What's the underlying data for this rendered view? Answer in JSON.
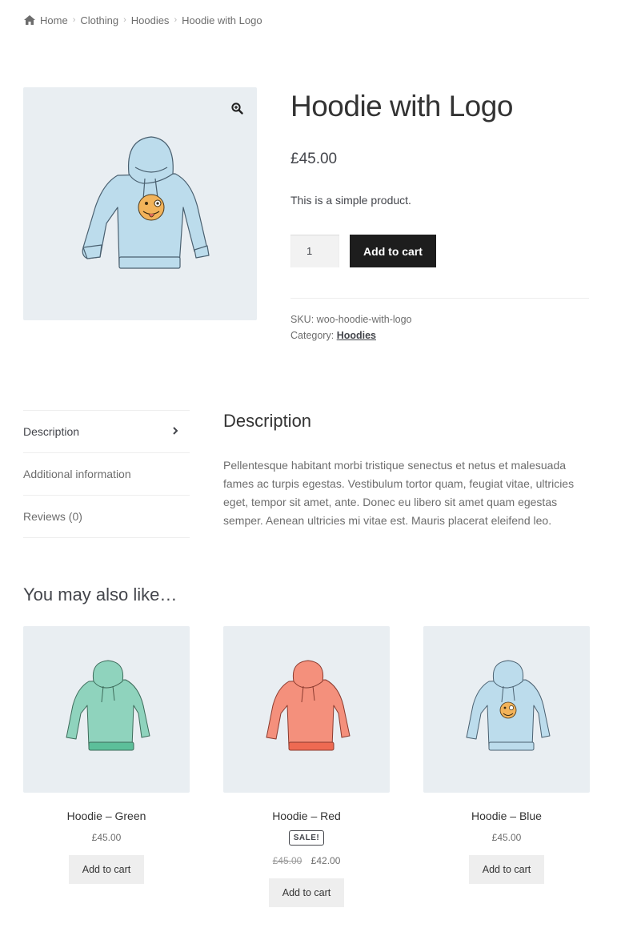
{
  "breadcrumb": {
    "icon": "home-icon",
    "items": [
      "Home",
      "Clothing",
      "Hoodies",
      "Hoodie with Logo"
    ]
  },
  "product": {
    "title": "Hoodie with Logo",
    "price": "£45.00",
    "short_description": "This is a simple product.",
    "quantity": "1",
    "add_to_cart_label": "Add to cart",
    "sku_label": "SKU:",
    "sku_value": "woo-hoodie-with-logo",
    "category_label": "Category:",
    "category_value": "Hoodies",
    "image_bg": "#e9eef2"
  },
  "tabs": [
    {
      "label": "Description",
      "active": true
    },
    {
      "label": "Additional information",
      "active": false
    },
    {
      "label": "Reviews (0)",
      "active": false
    }
  ],
  "description": {
    "heading": "Description",
    "body": "Pellentesque habitant morbi tristique senectus et netus et malesuada fames ac turpis egestas. Vestibulum tortor quam, feugiat vitae, ultricies eget, tempor sit amet, ante. Donec eu libero sit amet quam egestas semper. Aenean ultricies mi vitae est. Mauris placerat eleifend leo."
  },
  "related": {
    "heading": "You may also like…",
    "items": [
      {
        "name": "Hoodie – Green",
        "price": "£45.00",
        "button": "Add to cart",
        "color": "#8fd3bd"
      },
      {
        "name": "Hoodie – Red",
        "sale_badge": "SALE!",
        "old_price": "£45.00",
        "price": "£42.00",
        "button": "Add to cart",
        "color": "#f4907c"
      },
      {
        "name": "Hoodie – Blue",
        "price": "£45.00",
        "button": "Add to cart",
        "color": "#bcdcec"
      }
    ]
  },
  "colors": {
    "button_dark": "#1d1d1d",
    "hoodie_blue": "#bcdcec"
  }
}
